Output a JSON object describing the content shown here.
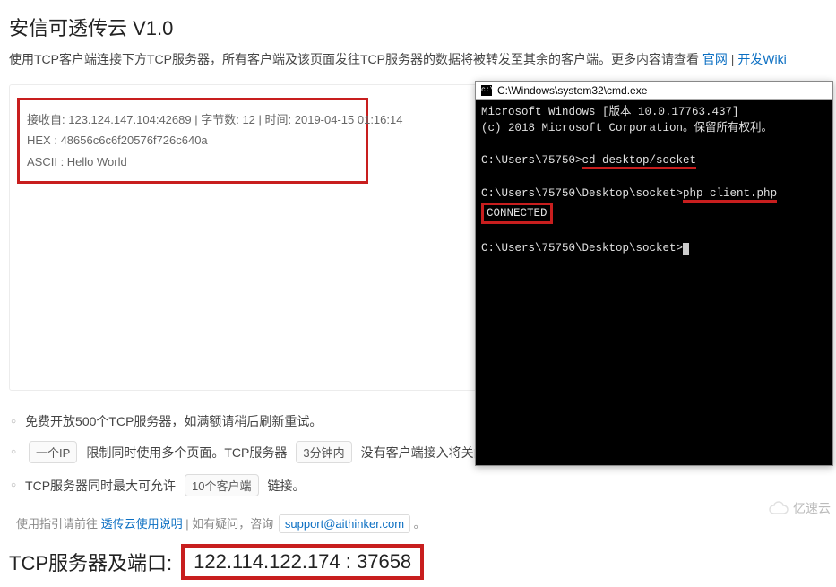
{
  "title": "安信可透传云 V1.0",
  "intro": {
    "text_prefix": "使用TCP客户端连接下方TCP服务器，所有客户端及该页面发往TCP服务器的数据将被转发至其余的客户端。更多内容请查看 ",
    "link1": "官网",
    "sep": " | ",
    "link2": "开发Wiki"
  },
  "received": {
    "line1_from_label": "接收自",
    "line1_from_value": ": 123.124.147.104:42689 | ",
    "line1_bytes_label": "字节数",
    "line1_bytes_value": ": 12 | ",
    "line1_time_label": "时间",
    "line1_time_value": ": 2019-04-15 01:16:14",
    "line2": "HEX   : 48656c6c6f20576f726c640a",
    "line3": "ASCII : Hello World"
  },
  "bullets": {
    "b1": "免费开放500个TCP服务器，如满额请稍后刷新重试。",
    "b2_pill": "一个IP",
    "b2_mid": " 限制同时使用多个页面。TCP服务器 ",
    "b2_pill2": "3分钟内",
    "b2_tail": " 没有客户端接入将关闭。",
    "b3_head": "TCP服务器同时最大可允许 ",
    "b3_pill": "10个客户端",
    "b3_tail": " 链接。"
  },
  "footer": {
    "prefix": "使用指引请前往 ",
    "link": "透传云使用说明",
    "mid": " | 如有疑问，咨询 ",
    "email": "support@aithinker.com",
    "tail": " 。"
  },
  "server": {
    "label": "TCP服务器及端口:",
    "value": "122.114.122.174 : 37658"
  },
  "cmd": {
    "title": "C:\\Windows\\system32\\cmd.exe",
    "l1": "Microsoft Windows [版本 10.0.17763.437]",
    "l2": "(c) 2018 Microsoft Corporation。保留所有权利。",
    "l3a": "C:\\Users\\75750>",
    "l3b": "cd desktop/socket",
    "l4a": "C:\\Users\\75750\\Desktop\\socket>",
    "l4b": "php client.php",
    "l5": "CONNECTED",
    "l6": "C:\\Users\\75750\\Desktop\\socket>"
  },
  "watermark": "亿速云"
}
